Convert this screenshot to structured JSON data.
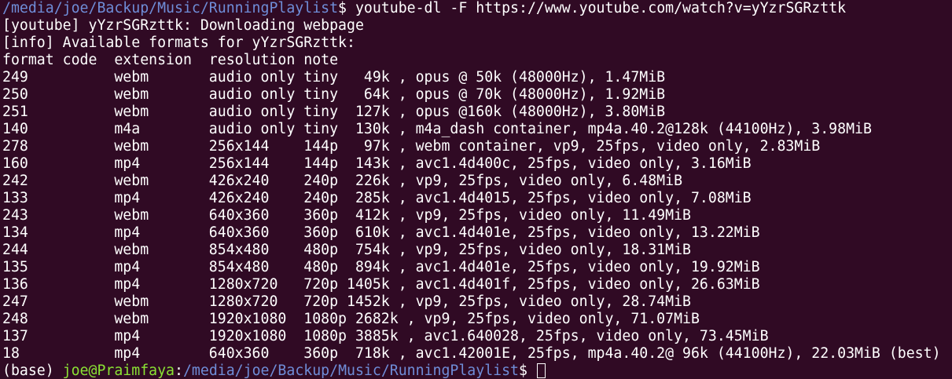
{
  "prompt1": {
    "path": "/media/joe/Backup/Music/RunningPlaylist",
    "symbol": "$",
    "command": " youtube-dl -F https://www.youtube.com/watch?v=yYzrSGRzttk"
  },
  "output_header": [
    "[youtube] yYzrSGRzttk: Downloading webpage",
    "[info] Available formats for yYzrSGRzttk:",
    "format code  extension  resolution note"
  ],
  "formats": [
    "249          webm       audio only tiny   49k , opus @ 50k (48000Hz), 1.47MiB",
    "250          webm       audio only tiny   64k , opus @ 70k (48000Hz), 1.92MiB",
    "251          webm       audio only tiny  127k , opus @160k (48000Hz), 3.80MiB",
    "140          m4a        audio only tiny  130k , m4a_dash container, mp4a.40.2@128k (44100Hz), 3.98MiB",
    "278          webm       256x144    144p   97k , webm container, vp9, 25fps, video only, 2.83MiB",
    "160          mp4        256x144    144p  143k , avc1.4d400c, 25fps, video only, 3.16MiB",
    "242          webm       426x240    240p  226k , vp9, 25fps, video only, 6.48MiB",
    "133          mp4        426x240    240p  285k , avc1.4d4015, 25fps, video only, 7.08MiB",
    "243          webm       640x360    360p  412k , vp9, 25fps, video only, 11.49MiB",
    "134          mp4        640x360    360p  610k , avc1.4d401e, 25fps, video only, 13.22MiB",
    "244          webm       854x480    480p  754k , vp9, 25fps, video only, 18.31MiB",
    "135          mp4        854x480    480p  894k , avc1.4d401e, 25fps, video only, 19.92MiB",
    "136          mp4        1280x720   720p 1405k , avc1.4d401f, 25fps, video only, 26.63MiB",
    "247          webm       1280x720   720p 1452k , vp9, 25fps, video only, 28.74MiB",
    "248          webm       1920x1080  1080p 2682k , vp9, 25fps, video only, 71.07MiB",
    "137          mp4        1920x1080  1080p 3885k , avc1.640028, 25fps, video only, 73.45MiB",
    "18           mp4        640x360    360p  718k , avc1.42001E, 25fps, mp4a.40.2@ 96k (44100Hz), 22.03MiB (best)"
  ],
  "prompt2": {
    "env": "(base) ",
    "user_host": "joe@Praimfaya",
    "colon": ":",
    "path": "/media/joe/Backup/Music/RunningPlaylist",
    "symbol": "$ "
  },
  "colors": {
    "background": "#300a24",
    "text": "#ffffff",
    "path": "#6f8dd8",
    "user_host": "#8ae234"
  }
}
